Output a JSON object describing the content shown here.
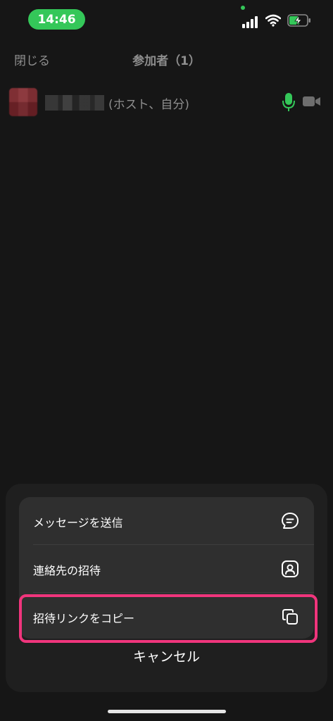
{
  "status_bar": {
    "time": "14:46"
  },
  "header": {
    "close_label": "閉じる",
    "title": "参加者（1）"
  },
  "participant": {
    "suffix": "(ホスト、自分)",
    "mic_color": "#34c759"
  },
  "sheet": {
    "items": [
      {
        "label": "メッセージを送信",
        "icon": "chat-bubble-icon"
      },
      {
        "label": "連絡先の招待",
        "icon": "contact-icon"
      },
      {
        "label": "招待リンクをコピー",
        "icon": "copy-icon"
      }
    ],
    "cancel_label": "キャンセル"
  },
  "colors": {
    "accent_green": "#34c759",
    "highlight_pink": "#f0357c",
    "sheet_bg": "#1f1f1f",
    "group_bg": "#2f2f2f"
  }
}
